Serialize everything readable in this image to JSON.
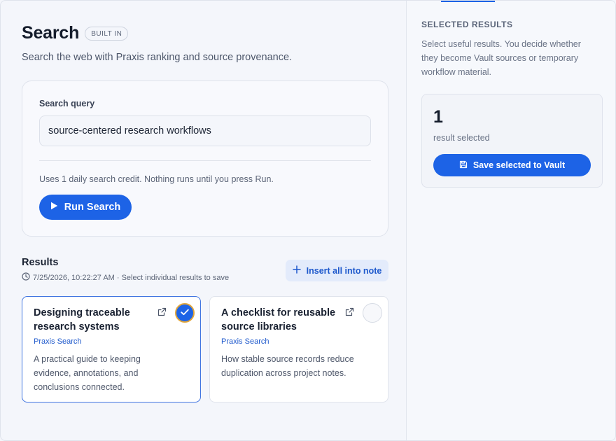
{
  "header": {
    "title": "Search",
    "badge": "BUILT IN",
    "subtitle": "Search the web with Praxis ranking and source provenance."
  },
  "query": {
    "label": "Search query",
    "value": "source-centered research workflows",
    "note": "Uses 1 daily search credit. Nothing runs until you press Run.",
    "run_label": "Run Search"
  },
  "results": {
    "title": "Results",
    "meta": "7/25/2026, 10:22:27 AM · Select individual results to save",
    "insert_label": "Insert all into note",
    "items": [
      {
        "title": "Designing traceable research systems",
        "source": "Praxis Search",
        "description": "A practical guide to keeping evidence, annotations, and conclusions connected.",
        "selected": true
      },
      {
        "title": "A checklist for reusable source libraries",
        "source": "Praxis Search",
        "description": "How stable source records reduce duplication across project notes.",
        "selected": false
      }
    ]
  },
  "sidebar": {
    "title": "SELECTED RESULTS",
    "description": "Select useful results. You decide whether they become Vault sources or temporary workflow material.",
    "count": "1",
    "count_label": "result selected",
    "save_label": "Save selected to Vault"
  },
  "colors": {
    "accent": "#1d63e6",
    "selection_ring": "#e2a63b",
    "background": "#f4f6fb"
  },
  "icons": [
    "play-icon",
    "plus-icon",
    "clock-icon",
    "external-link-icon",
    "check-icon",
    "save-icon"
  ]
}
